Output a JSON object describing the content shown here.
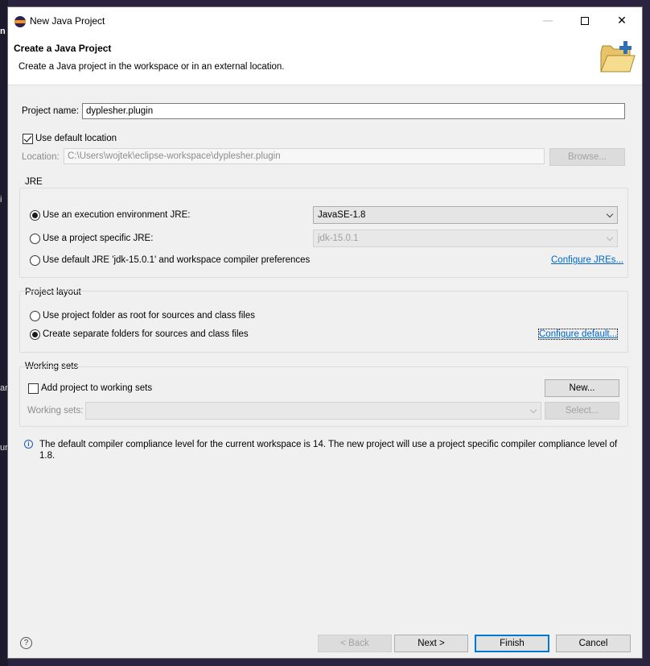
{
  "window": {
    "title": "New Java Project"
  },
  "banner": {
    "title": "Create a Java Project",
    "description": "Create a Java project in the workspace or in an external location."
  },
  "project": {
    "name_label": "Project name:",
    "name_value": "dyplesher.plugin",
    "use_default_location_label": "Use default location",
    "use_default_location_checked": true,
    "location_label": "Location:",
    "location_value": "C:\\Users\\wojtek\\eclipse-workspace\\dyplesher.plugin",
    "browse_label": "Browse..."
  },
  "jre": {
    "group_title": "JRE",
    "exec_env_label": "Use an execution environment JRE:",
    "exec_env_value": "JavaSE-1.8",
    "specific_label": "Use a project specific JRE:",
    "specific_value": "jdk-15.0.1",
    "default_label": "Use default JRE 'jdk-15.0.1' and workspace compiler preferences",
    "configure_link": "Configure JREs...",
    "selected": "exec_env"
  },
  "layout": {
    "group_title": "Project layout",
    "root_label": "Use project folder as root for sources and class files",
    "separate_label": "Create separate folders for sources and class files",
    "configure_link": "Configure default...",
    "selected": "separate"
  },
  "working_sets": {
    "group_title": "Working sets",
    "add_label": "Add project to working sets",
    "add_checked": false,
    "new_button": "New...",
    "sets_label": "Working sets:",
    "select_button": "Select..."
  },
  "info": {
    "message": "The default compiler compliance level for the current workspace is 14. The new project will use a project specific compiler compliance level of 1.8."
  },
  "footer": {
    "back": "< Back",
    "next": "Next >",
    "finish": "Finish",
    "cancel": "Cancel"
  },
  "colors": {
    "link": "#0066cc",
    "primary_border": "#0078d7",
    "dialog_bg": "#f0f0f0"
  },
  "icons": [
    "eclipse-app-icon",
    "folder-wizard-icon",
    "info-icon",
    "help-icon"
  ],
  "background_fragments": [
    "n",
    "i",
    "ar",
    "ur"
  ]
}
